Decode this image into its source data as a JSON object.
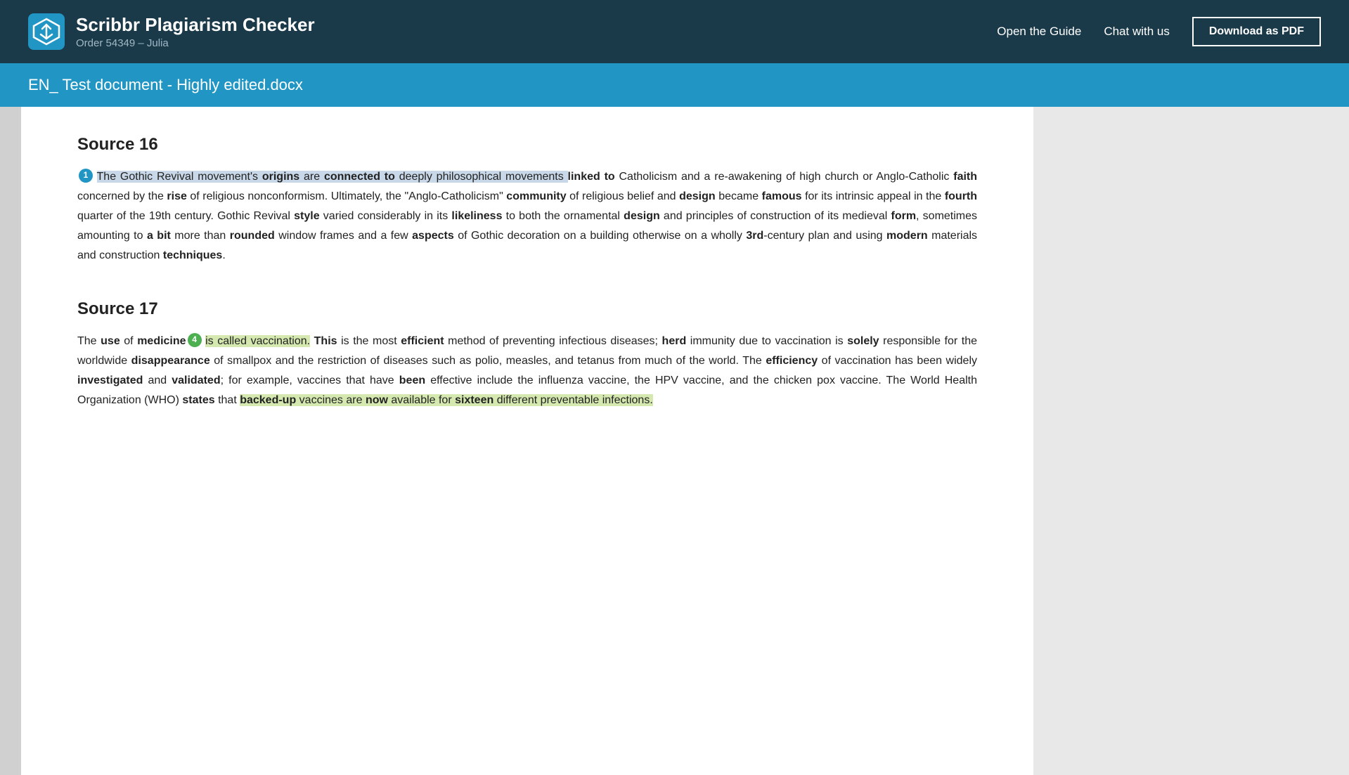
{
  "header": {
    "logo_alt": "Scribbr logo",
    "title": "Scribbr Plagiarism Checker",
    "subtitle": "Order 54349 – Julia",
    "open_guide_label": "Open the Guide",
    "chat_label": "Chat with us",
    "download_label": "Download as PDF"
  },
  "doc_title_bar": {
    "title": "EN_ Test document - Highly edited.docx"
  },
  "sources": [
    {
      "id": "source16",
      "title": "Source 16",
      "badge_number": "1",
      "badge_color": "blue",
      "paragraphs": [
        {
          "id": "p16",
          "segments": [
            {
              "text": "The Gothic Revival movement's ",
              "style": "hl-blue"
            },
            {
              "text": "origins",
              "style": "hl-blue bold"
            },
            {
              "text": " are ",
              "style": "hl-blue"
            },
            {
              "text": "connected to",
              "style": "hl-blue bold"
            },
            {
              "text": " deeply philosophical movements ",
              "style": "hl-blue"
            },
            {
              "text": "linked to",
              "style": "bold"
            },
            {
              "text": " Catholicism and a re-awakening of high church or Anglo-Catholic ",
              "style": ""
            },
            {
              "text": "faith",
              "style": "bold"
            },
            {
              "text": " concerned by the ",
              "style": ""
            },
            {
              "text": "rise",
              "style": "bold"
            },
            {
              "text": " of religious nonconformism. Ultimately, the \"Anglo-Catholicism\" ",
              "style": ""
            },
            {
              "text": "community",
              "style": "bold"
            },
            {
              "text": " of religious belief and ",
              "style": ""
            },
            {
              "text": "design",
              "style": "bold"
            },
            {
              "text": " became ",
              "style": ""
            },
            {
              "text": "famous",
              "style": "bold"
            },
            {
              "text": " for its intrinsic appeal in the ",
              "style": ""
            },
            {
              "text": "fourth",
              "style": "bold"
            },
            {
              "text": " quarter of the 19th century. Gothic Revival ",
              "style": ""
            },
            {
              "text": "style",
              "style": "bold"
            },
            {
              "text": " varied considerably in its ",
              "style": ""
            },
            {
              "text": "likeliness",
              "style": "bold"
            },
            {
              "text": " to both the ornamental ",
              "style": ""
            },
            {
              "text": "design",
              "style": "bold"
            },
            {
              "text": " and principles of construction of its medieval ",
              "style": ""
            },
            {
              "text": "form",
              "style": "bold"
            },
            {
              "text": ", sometimes amounting to ",
              "style": ""
            },
            {
              "text": "a bit",
              "style": "bold"
            },
            {
              "text": " more than ",
              "style": ""
            },
            {
              "text": "rounded",
              "style": "bold"
            },
            {
              "text": " window frames and a few ",
              "style": ""
            },
            {
              "text": "aspects",
              "style": "bold"
            },
            {
              "text": " of Gothic decoration on a building otherwise on a wholly ",
              "style": ""
            },
            {
              "text": "3rd",
              "style": "bold"
            },
            {
              "text": "-century plan and using ",
              "style": ""
            },
            {
              "text": "modern",
              "style": "bold"
            },
            {
              "text": " materials and construction ",
              "style": ""
            },
            {
              "text": "techniques",
              "style": "bold"
            },
            {
              "text": ".",
              "style": ""
            }
          ]
        }
      ]
    },
    {
      "id": "source17",
      "title": "Source 17",
      "badge_number": "4",
      "badge_color": "green",
      "paragraphs": [
        {
          "id": "p17",
          "segments": [
            {
              "text": "The ",
              "style": ""
            },
            {
              "text": "use",
              "style": "bold"
            },
            {
              "text": " of ",
              "style": ""
            },
            {
              "text": "medicine",
              "style": "bold"
            },
            {
              "text": " is called vaccination. ",
              "style": "hl-yellow"
            },
            {
              "text": "This",
              "style": "bold"
            },
            {
              "text": " is the most ",
              "style": ""
            },
            {
              "text": "efficient",
              "style": "bold"
            },
            {
              "text": " method of preventing infectious diseases; ",
              "style": ""
            },
            {
              "text": "herd",
              "style": "bold"
            },
            {
              "text": " immunity due to vaccination is ",
              "style": ""
            },
            {
              "text": "solely",
              "style": "bold"
            },
            {
              "text": " responsible for the worldwide ",
              "style": ""
            },
            {
              "text": "disappearance",
              "style": "bold"
            },
            {
              "text": " of smallpox and the restriction of diseases such as polio, measles, and tetanus from much of the world. The ",
              "style": ""
            },
            {
              "text": "efficiency",
              "style": "bold"
            },
            {
              "text": " of vaccination has been widely ",
              "style": ""
            },
            {
              "text": "investigated",
              "style": "bold"
            },
            {
              "text": " and ",
              "style": ""
            },
            {
              "text": "validated",
              "style": "bold"
            },
            {
              "text": "; for example, vaccines that have ",
              "style": ""
            },
            {
              "text": "been",
              "style": "bold"
            },
            {
              "text": " effective include the influenza vaccine, the HPV vaccine, and the chicken pox vaccine. The World Health Organization (WHO) ",
              "style": ""
            },
            {
              "text": "states",
              "style": "bold"
            },
            {
              "text": " that ",
              "style": ""
            },
            {
              "text": "backed-up",
              "style": "hl-yellow bold"
            },
            {
              "text": " vaccines are ",
              "style": "hl-yellow"
            },
            {
              "text": "now",
              "style": "hl-yellow bold"
            },
            {
              "text": " available for ",
              "style": "hl-yellow"
            },
            {
              "text": "sixteen",
              "style": "hl-yellow bold"
            },
            {
              "text": " different preventable infections.",
              "style": "hl-yellow"
            }
          ]
        }
      ]
    }
  ]
}
